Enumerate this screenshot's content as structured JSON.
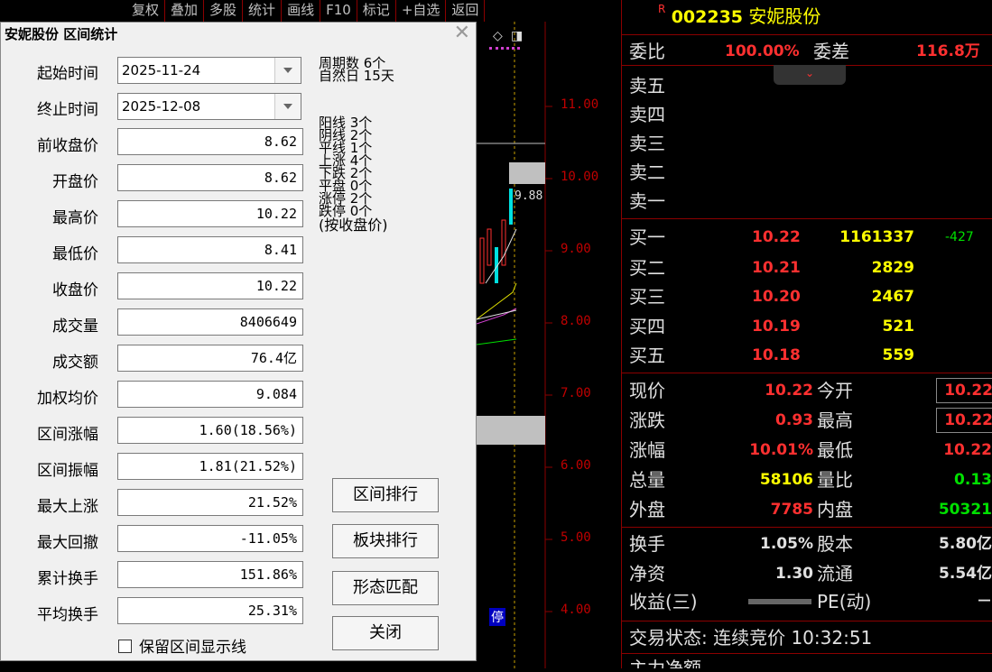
{
  "toolbar": {
    "items": [
      "复权",
      "叠加",
      "多股",
      "统计",
      "画线",
      "F10",
      "标记",
      "+自选",
      "返回"
    ]
  },
  "chart": {
    "y_labels": [
      "11.00",
      "10.00",
      "9.00",
      "8.00",
      "7.00",
      "6.00",
      "5.00",
      "4.00"
    ],
    "price_tag": "9.88",
    "halt_label": "停"
  },
  "dialog": {
    "title": "安妮股份 区间统计",
    "fields": [
      {
        "label": "起始时间",
        "value": "2025-11-24"
      },
      {
        "label": "终止时间",
        "value": "2025-12-08"
      },
      {
        "label": "前收盘价",
        "value": "8.62"
      },
      {
        "label": "开盘价",
        "value": "8.62"
      },
      {
        "label": "最高价",
        "value": "10.22"
      },
      {
        "label": "最低价",
        "value": "8.41"
      },
      {
        "label": "收盘价",
        "value": "10.22"
      },
      {
        "label": "成交量",
        "value": "8406649"
      },
      {
        "label": "成交额",
        "value": "76.4亿"
      },
      {
        "label": "加权均价",
        "value": "9.084"
      },
      {
        "label": "区间涨幅",
        "value": "1.60(18.56%)"
      },
      {
        "label": "区间振幅",
        "value": "1.81(21.52%)"
      },
      {
        "label": "最大上涨",
        "value": "21.52%"
      },
      {
        "label": "最大回撤",
        "value": "-11.05%"
      },
      {
        "label": "累计换手",
        "value": "151.86%"
      },
      {
        "label": "平均换手",
        "value": "25.31%"
      }
    ],
    "stats": [
      "周期数 6个",
      "自然日 15天",
      "阳线 3个",
      "阴线 2个",
      "平线 1个",
      "上涨 4个",
      "下跌 2个",
      "平盘 0个",
      "涨停 2个",
      "跌停 0个",
      "(按收盘价)"
    ],
    "buttons": {
      "range_rank": "区间排行",
      "sector_rank": "板块排行",
      "pattern_match": "形态匹配",
      "close": "关闭"
    },
    "checkbox_label": "保留区间显示线"
  },
  "quote": {
    "code": "002235",
    "name": "安妮股份",
    "r_mark": "R",
    "weibi_label": "委比",
    "weibi_value": "100.00%",
    "weicha_label": "委差",
    "weicha_value": "116.8万",
    "sell_levels": [
      "卖五",
      "卖四",
      "卖三",
      "卖二",
      "卖一"
    ],
    "buy_levels": [
      {
        "label": "买一",
        "price": "10.22",
        "vol": "1161337",
        "chg": "-427"
      },
      {
        "label": "买二",
        "price": "10.21",
        "vol": "2829",
        "chg": ""
      },
      {
        "label": "买三",
        "price": "10.20",
        "vol": "2467",
        "chg": ""
      },
      {
        "label": "买四",
        "price": "10.19",
        "vol": "521",
        "chg": ""
      },
      {
        "label": "买五",
        "price": "10.18",
        "vol": "559",
        "chg": ""
      }
    ],
    "stats": [
      {
        "l1": "现价",
        "v1": "10.22",
        "l2": "今开",
        "v2": "10.22"
      },
      {
        "l1": "涨跌",
        "v1": "0.93",
        "l2": "最高",
        "v2": "10.22"
      },
      {
        "l1": "涨幅",
        "v1": "10.01%",
        "l2": "最低",
        "v2": "10.22"
      },
      {
        "l1": "总量",
        "v1": "58106",
        "l2": "量比",
        "v2": "0.13"
      },
      {
        "l1": "外盘",
        "v1": "7785",
        "l2": "内盘",
        "v2": "50321"
      }
    ],
    "stats2": [
      {
        "l1": "换手",
        "v1": "1.05%",
        "l2": "股本",
        "v2": "5.80亿"
      },
      {
        "l1": "净资",
        "v1": "1.30",
        "l2": "流通",
        "v2": "5.54亿"
      },
      {
        "l1": "收益(三)",
        "v1": "",
        "l2": "PE(动)",
        "v2": "－"
      }
    ],
    "trade_status": "交易状态: 连续竞价 10:32:51",
    "bottom_partial": "主力净额"
  },
  "colors": {
    "up": "#ff3030",
    "down": "#00e000",
    "volume": "#ffff00",
    "frame": "#8b0000"
  }
}
